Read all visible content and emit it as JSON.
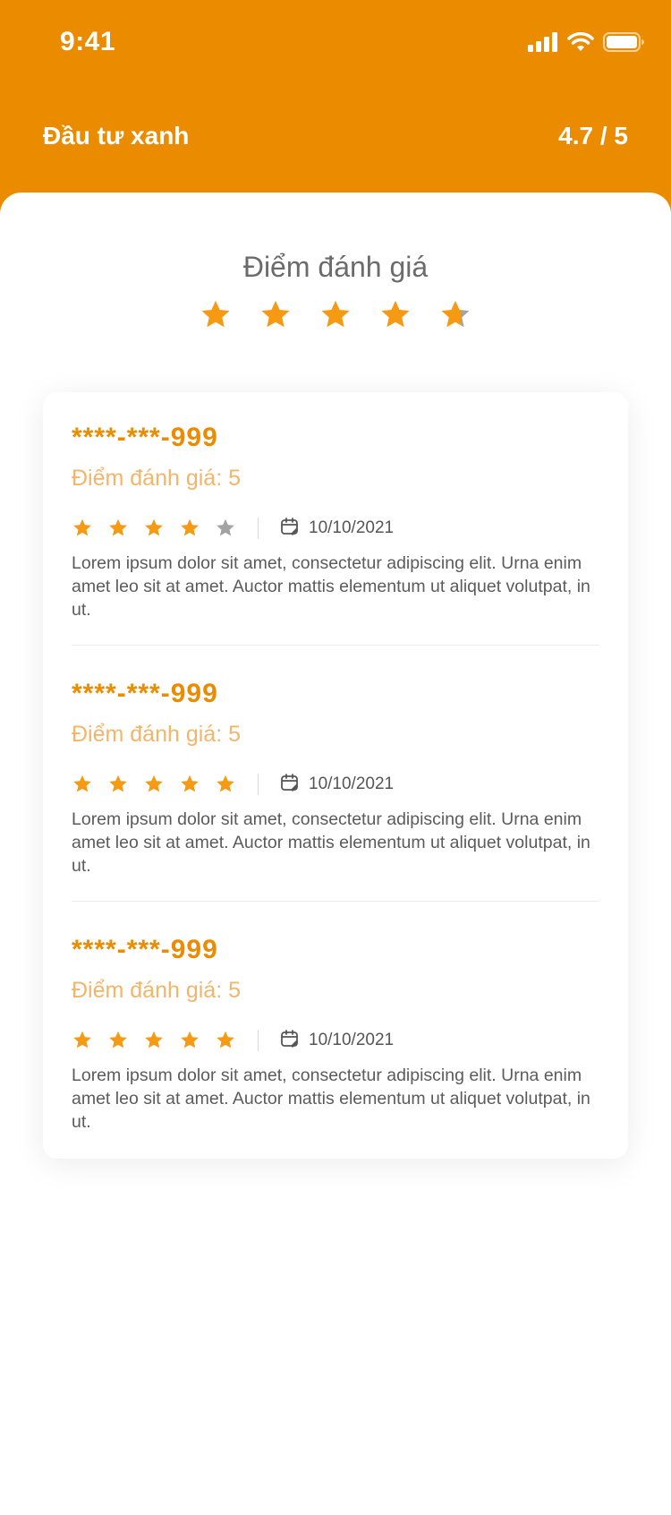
{
  "status_bar": {
    "time": "9:41"
  },
  "header": {
    "title": "Đầu tư xanh",
    "rating": "4.7 / 5"
  },
  "overall": {
    "title": "Điểm đánh giá",
    "rating_value": 4.7,
    "max_rating": 5
  },
  "colors": {
    "brand": "#EB8C00",
    "star_filled": "#F59A12",
    "star_empty": "#A3A3A3",
    "score_text": "#F2B56A"
  },
  "reviews": [
    {
      "name": "****-***-999",
      "score_label": "Điểm đánh giá: 5",
      "stars": 4,
      "date": "10/10/2021",
      "text": "Lorem ipsum dolor sit amet, consectetur adipiscing elit. Urna enim amet leo sit at amet. Auctor mattis elementum ut aliquet volutpat, in ut."
    },
    {
      "name": "****-***-999",
      "score_label": "Điểm đánh giá: 5",
      "stars": 5,
      "date": "10/10/2021",
      "text": "Lorem ipsum dolor sit amet, consectetur adipiscing elit. Urna enim amet leo sit at amet. Auctor mattis elementum ut aliquet volutpat, in ut."
    },
    {
      "name": "****-***-999",
      "score_label": "Điểm đánh giá: 5",
      "stars": 5,
      "date": "10/10/2021",
      "text": "Lorem ipsum dolor sit amet, consectetur adipiscing elit. Urna enim amet leo sit at amet. Auctor mattis elementum ut aliquet volutpat, in ut."
    }
  ]
}
